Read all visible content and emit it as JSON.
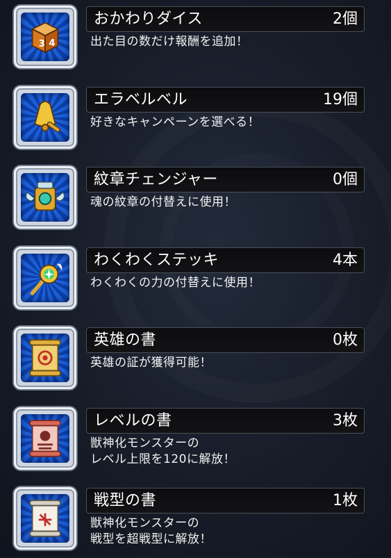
{
  "items": [
    {
      "name": "おかわりダイス",
      "count": "2個",
      "desc": "出た目の数だけ報酬を追加！",
      "icon": "dice-icon"
    },
    {
      "name": "エラベルベル",
      "count": "19個",
      "desc": "好きなキャンペーンを選べる！",
      "icon": "bell-icon"
    },
    {
      "name": "紋章チェンジャー",
      "count": "0個",
      "desc": "魂の紋章の付替えに使用！",
      "icon": "crest-changer-icon"
    },
    {
      "name": "わくわくステッキ",
      "count": "4本",
      "desc": "わくわくの力の付替えに使用！",
      "icon": "wand-icon"
    },
    {
      "name": "英雄の書",
      "count": "0枚",
      "desc": "英雄の証が獲得可能！",
      "icon": "hero-scroll-icon"
    },
    {
      "name": "レベルの書",
      "count": "3枚",
      "desc": "獣神化モンスターの\nレベル上限を120に解放！",
      "icon": "level-scroll-icon"
    },
    {
      "name": "戦型の書",
      "count": "1枚",
      "desc": "獣神化モンスターの\n戦型を超戦型に解放！",
      "icon": "battle-type-scroll-icon"
    }
  ],
  "colors": {
    "panel": "#0c0c0e",
    "frame": "#eef2f7",
    "icon_bg": "#1d5fd6"
  }
}
